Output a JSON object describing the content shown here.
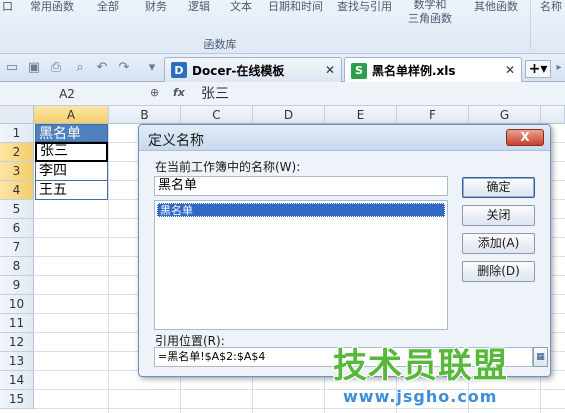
{
  "ribbon": {
    "items": [
      "口",
      "常用函数",
      "全部",
      "财务",
      "逻辑",
      "文本",
      "日期和时间",
      "查找与引用",
      "数学和\n三角函数",
      "其他函数",
      "名称"
    ],
    "group_label": "函数库"
  },
  "tabs": [
    {
      "label": "Docer-在线模板",
      "icon": "D",
      "icon_color": "#2b6cc4"
    },
    {
      "label": "黑名单样例.xls",
      "icon": "S",
      "icon_color": "#2e9e4a"
    }
  ],
  "formula_bar": {
    "name_box": "A2",
    "fx": "fx",
    "value": "张三"
  },
  "columns": [
    "A",
    "B",
    "C",
    "D",
    "E",
    "F",
    "G"
  ],
  "rows": [
    "1",
    "2",
    "3",
    "4",
    "5",
    "6",
    "7",
    "8",
    "9",
    "10",
    "11",
    "12",
    "13",
    "14",
    "15"
  ],
  "cells": {
    "a1": "黑名单",
    "a2": "张三",
    "a3": "李四",
    "a4": "王五"
  },
  "dialog": {
    "title": "定义名称",
    "close": "X",
    "names_label": "在当前工作簿中的名称(W):",
    "name_value": "黑名单",
    "list_items": [
      "黑名单"
    ],
    "buttons": {
      "ok": "确定",
      "close": "关闭",
      "add": "添加(A)",
      "delete": "删除(D)"
    },
    "ref_label": "引用位置(R):",
    "ref_value": "=黑名单!$A$2:$A$4",
    "ref_button": "▦"
  },
  "watermark": {
    "title": "技术员联盟",
    "url": "www.jsgho.com"
  },
  "colors": {
    "accent": "#4f81bd",
    "selection": "#316ac5",
    "close_red": "#c7402a"
  }
}
